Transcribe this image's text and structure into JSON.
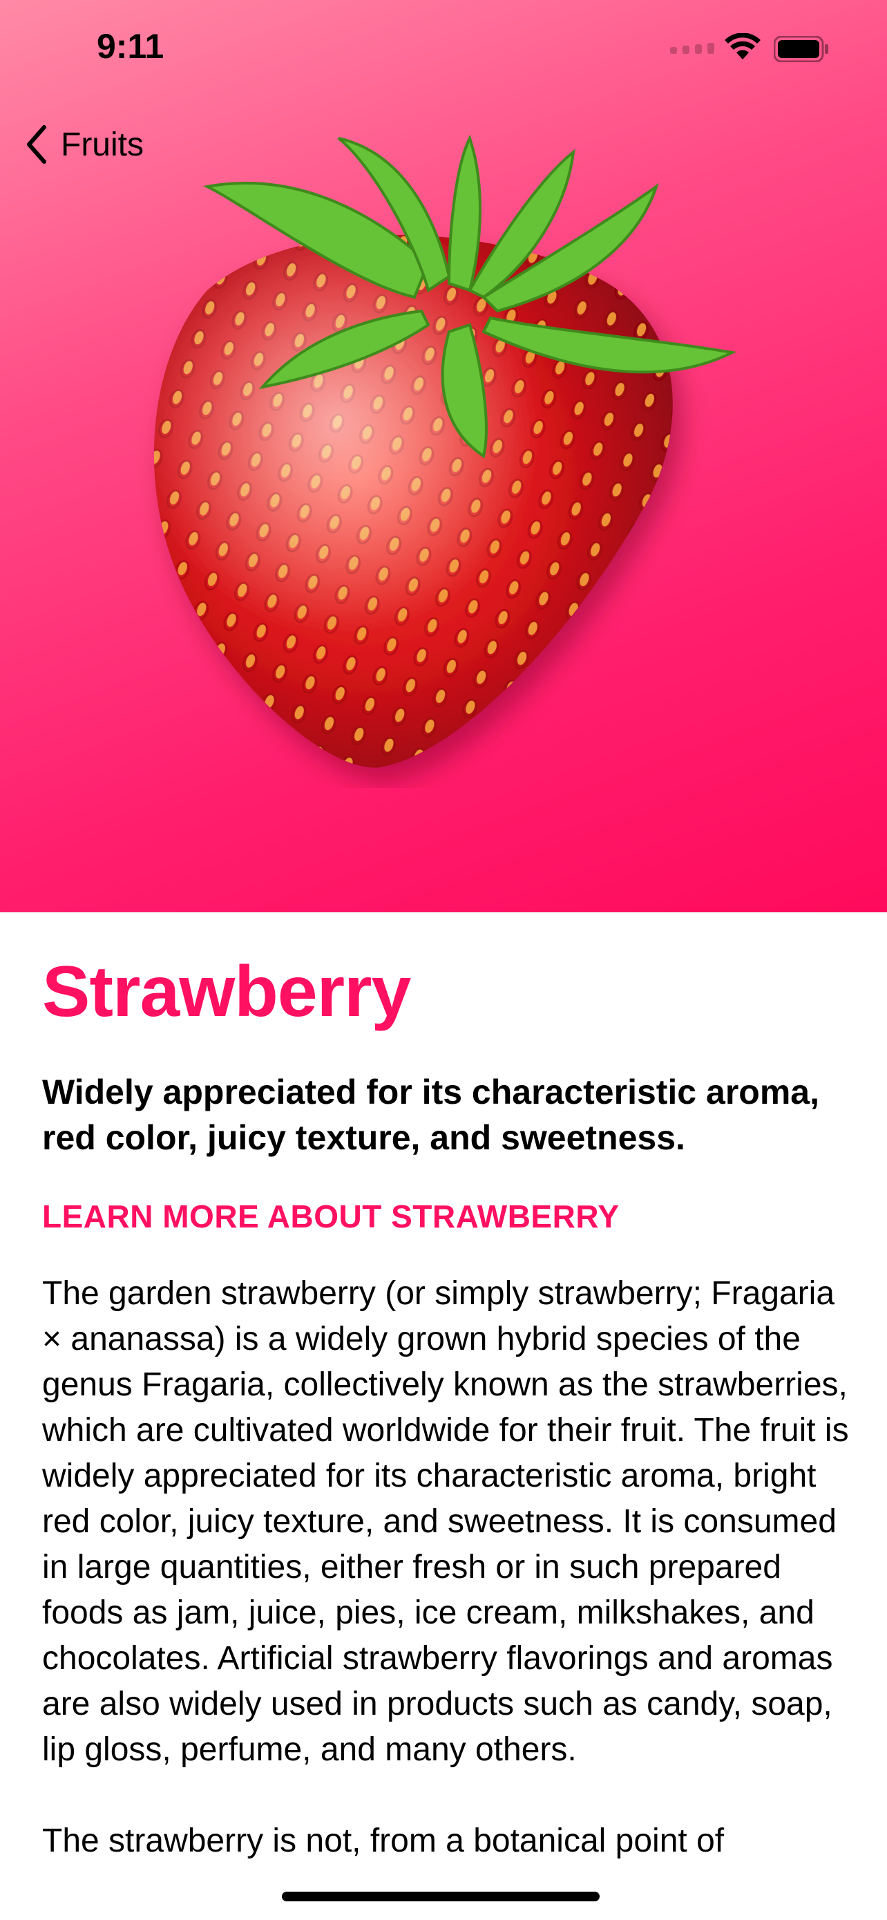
{
  "status_bar": {
    "time": "9:11"
  },
  "nav": {
    "back_label": "Fruits"
  },
  "hero": {
    "image": "strawberry-image",
    "gradient_colors": [
      "#ff8aa6",
      "#ff0a5c"
    ]
  },
  "fruit": {
    "title": "Strawberry",
    "headline": "Widely appreciated for its characteristic aroma, red color, juicy texture, and sweetness.",
    "learn_more": "LEARN MORE ABOUT STRAWBERRY",
    "description": "The garden strawberry (or simply strawberry; Fragaria × ananassa) is a widely grown hybrid species of the genus Fragaria, collectively known as the strawberries, which are cultivated worldwide for their fruit. The fruit is widely appreciated for its characteristic aroma, bright red color, juicy texture, and sweetness. It is consumed in large quantities, either fresh or in such prepared foods as jam, juice, pies, ice cream, milkshakes, and chocolates. Artificial strawberry flavorings and aromas are also widely used in products such as candy, soap, lip gloss, perfume, and many others.",
    "description_continued": "The strawberry is not, from a botanical point of"
  },
  "colors": {
    "accent": "#ff1060"
  }
}
